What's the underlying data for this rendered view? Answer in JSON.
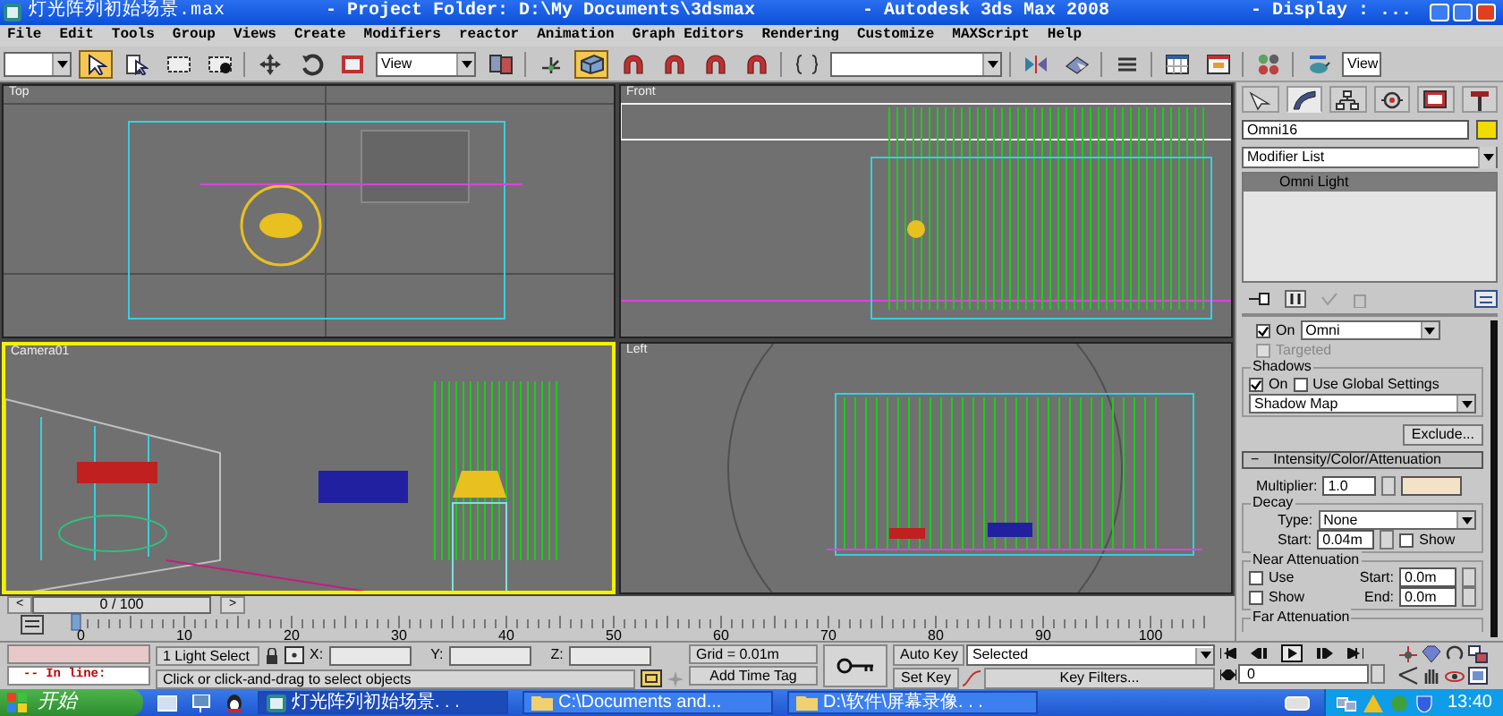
{
  "window": {
    "title_parts": [
      "灯光阵列初始场景.max",
      "- Project Folder: D:\\My Documents\\3dsmax",
      "- Autodesk 3ds Max 2008",
      "- Display : ..."
    ]
  },
  "menu": [
    "File",
    "Edit",
    "Tools",
    "Group",
    "Views",
    "Create",
    "Modifiers",
    "reactor",
    "Animation",
    "Graph Editors",
    "Rendering",
    "Customize",
    "MAXScript",
    "Help"
  ],
  "toolbar": [
    {
      "kind": "dropdown"
    },
    {
      "kind": "cursor",
      "pressed": true
    },
    {
      "kind": "selectlist",
      "pressed": false
    },
    {
      "kind": "rect",
      "pressed": false
    },
    {
      "kind": "rectdot",
      "pressed": false
    },
    {
      "kind": "sep"
    },
    {
      "kind": "move",
      "pressed": false
    },
    {
      "kind": "rotate",
      "pressed": false
    },
    {
      "kind": "square",
      "pressed": false
    },
    {
      "kind": "dropdown",
      "value": "View"
    },
    {
      "kind": "screens",
      "pressed": false
    },
    {
      "kind": "sep"
    },
    {
      "kind": "axis",
      "pressed": false
    },
    {
      "kind": "box",
      "pressed": true
    },
    {
      "kind": "magnet",
      "pressed": false
    },
    {
      "kind": "magnet",
      "pressed": false
    },
    {
      "kind": "magnet",
      "pressed": false
    },
    {
      "kind": "magnet",
      "pressed": false
    },
    {
      "kind": "sep"
    },
    {
      "kind": "braces",
      "pressed": false
    },
    {
      "kind": "dropdown"
    },
    {
      "kind": "sep"
    },
    {
      "kind": "mirror",
      "pressed": false
    },
    {
      "kind": "eraser",
      "pressed": false
    },
    {
      "kind": "sep"
    },
    {
      "kind": "layers",
      "pressed": false
    },
    {
      "kind": "sep"
    },
    {
      "kind": "gridwin",
      "pressed": false
    },
    {
      "kind": "window",
      "pressed": false
    },
    {
      "kind": "sep"
    },
    {
      "kind": "spheres",
      "pressed": false
    },
    {
      "kind": "sep"
    },
    {
      "kind": "teapot",
      "pressed": false
    },
    {
      "kind": "dropdown",
      "value": "View"
    }
  ],
  "viewports": [
    {
      "label": "Top",
      "kind": "top",
      "active": false
    },
    {
      "label": "Front",
      "kind": "front",
      "active": false
    },
    {
      "label": "Camera01",
      "kind": "camera",
      "active": true
    },
    {
      "label": "Left",
      "kind": "left",
      "active": false
    }
  ],
  "command_panel": {
    "tabs": [
      {
        "kind": "create",
        "selected": false
      },
      {
        "kind": "modify",
        "selected": true
      },
      {
        "kind": "hierarchy",
        "selected": false
      },
      {
        "kind": "motion",
        "selected": false
      },
      {
        "kind": "display",
        "selected": false
      },
      {
        "kind": "utilities",
        "selected": false
      }
    ],
    "object": {
      "name": "Omni16",
      "color": "#f0dc00"
    },
    "modifier_list": "Modifier List",
    "stack": [
      {
        "label": "Omni Light",
        "selected": true
      }
    ],
    "light_on": true,
    "light_on_label": "On",
    "light_type": "Omni",
    "targeted_label": "Targeted",
    "targeted": false,
    "targeted_disabled": true,
    "shadows": {
      "title": "Shadows",
      "on": true,
      "on_label": "On",
      "use_global": false,
      "use_global_label": "Use Global Settings",
      "type": "Shadow Map",
      "exclude": "Exclude..."
    },
    "intensity": {
      "symbol": "−",
      "title": "Intensity/Color/Attenuation",
      "expanded": true,
      "multiplier_label": "Multiplier:",
      "multiplier": "1.0",
      "color": "#f3e2c6",
      "decay_title": "Decay",
      "type_label": "Type:",
      "type": "None",
      "start_label": "Start:",
      "start": "0.04m",
      "show_label": "Show",
      "show": false,
      "near_title": "Near Attenuation",
      "use_label": "Use",
      "use": false,
      "near_show_label": "Show",
      "near_show": false,
      "near_start_label": "Start:",
      "near_start": "0.0m",
      "near_end_label": "End:",
      "near_end": "0.0m",
      "far_title": "Far Attenuation"
    }
  },
  "timeline": {
    "slider": "0 / 100",
    "level": 0,
    "prev": "<",
    "next": ">",
    "ruler_labels": [
      "0",
      "10",
      "20",
      "30",
      "40",
      "50",
      "60",
      "70",
      "80",
      "90",
      "100"
    ]
  },
  "status": {
    "listener": "-- In line:",
    "selection": "1 Light Select",
    "x_label": "X:",
    "y_label": "Y:",
    "z_label": "Z:",
    "grid": "Grid = 0.01m",
    "prompt": "Click or click-and-drag to select objects",
    "add_time_tag": "Add Time Tag",
    "auto_key": "Auto Key",
    "set_key": "Set Key",
    "key_mode": "Selected",
    "key_filters": "Key Filters...",
    "frame": "0"
  },
  "taskbar": {
    "start": "开始",
    "tasks": [
      {
        "label": "灯光阵列初始场景. . .",
        "kind": "max",
        "selected": true
      },
      {
        "label": "C:\\Documents and...",
        "kind": "folder",
        "selected": false
      },
      {
        "label": "D:\\软件\\屏幕录像. . .",
        "kind": "folder",
        "selected": false
      }
    ],
    "clock": "13:40"
  }
}
